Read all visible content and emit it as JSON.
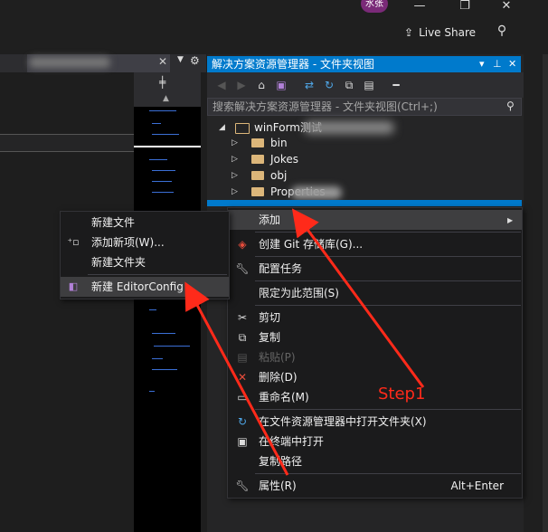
{
  "titlebar": {
    "avatar_text": "水张",
    "minimize_icon": "—",
    "restore_icon": "❐",
    "close_icon": "✕"
  },
  "toolbar": {
    "live_share_label": "Live Share"
  },
  "solution_explorer": {
    "title": "解决方案资源管理器 - 文件夹视图",
    "search_placeholder": "搜索解决方案资源管理器 - 文件夹视图(Ctrl+;)",
    "tree": [
      {
        "label": "winForm测试",
        "type": "root"
      },
      {
        "label": "bin",
        "type": "folder"
      },
      {
        "label": "Jokes",
        "type": "folder"
      },
      {
        "label": "obj",
        "type": "folder"
      },
      {
        "label": "Properties",
        "type": "folder"
      }
    ]
  },
  "context_menu": {
    "items": [
      {
        "label": "添加",
        "icon": "",
        "shortcut": "",
        "has_submenu": true
      },
      {
        "label": "创建 Git 存储库(G)...",
        "icon": "git-icon"
      },
      {
        "label": "配置任务",
        "icon": "wrench-icon"
      },
      {
        "label": "限定为此范围(S)",
        "icon": ""
      },
      {
        "label": "剪切",
        "icon": "scissors-icon"
      },
      {
        "label": "复制",
        "icon": "copy-icon"
      },
      {
        "label": "粘贴(P)",
        "icon": "paste-icon",
        "disabled": true
      },
      {
        "label": "删除(D)",
        "icon": "delete-icon"
      },
      {
        "label": "重命名(M)",
        "icon": "rename-icon"
      },
      {
        "label": "在文件资源管理器中打开文件夹(X)",
        "icon": "refresh-icon"
      },
      {
        "label": "在终端中打开",
        "icon": "terminal-icon"
      },
      {
        "label": "复制路径",
        "icon": ""
      },
      {
        "label": "属性(R)",
        "icon": "wrench-icon",
        "shortcut": "Alt+Enter"
      }
    ]
  },
  "submenu": {
    "items": [
      {
        "label": "新建文件"
      },
      {
        "label": "添加新项(W)...",
        "icon": "new-item-icon"
      },
      {
        "label": "新建文件夹"
      },
      {
        "label": "新建 EditorConfig",
        "icon": "editorconfig-icon"
      }
    ]
  },
  "annotation": {
    "step_label": "Step1",
    "color": "#ff2a1a"
  },
  "colors": {
    "accent": "#007acc",
    "background": "#1e1e1e",
    "menu_bg": "#1b1b1c",
    "highlight": "#3e3e40"
  }
}
